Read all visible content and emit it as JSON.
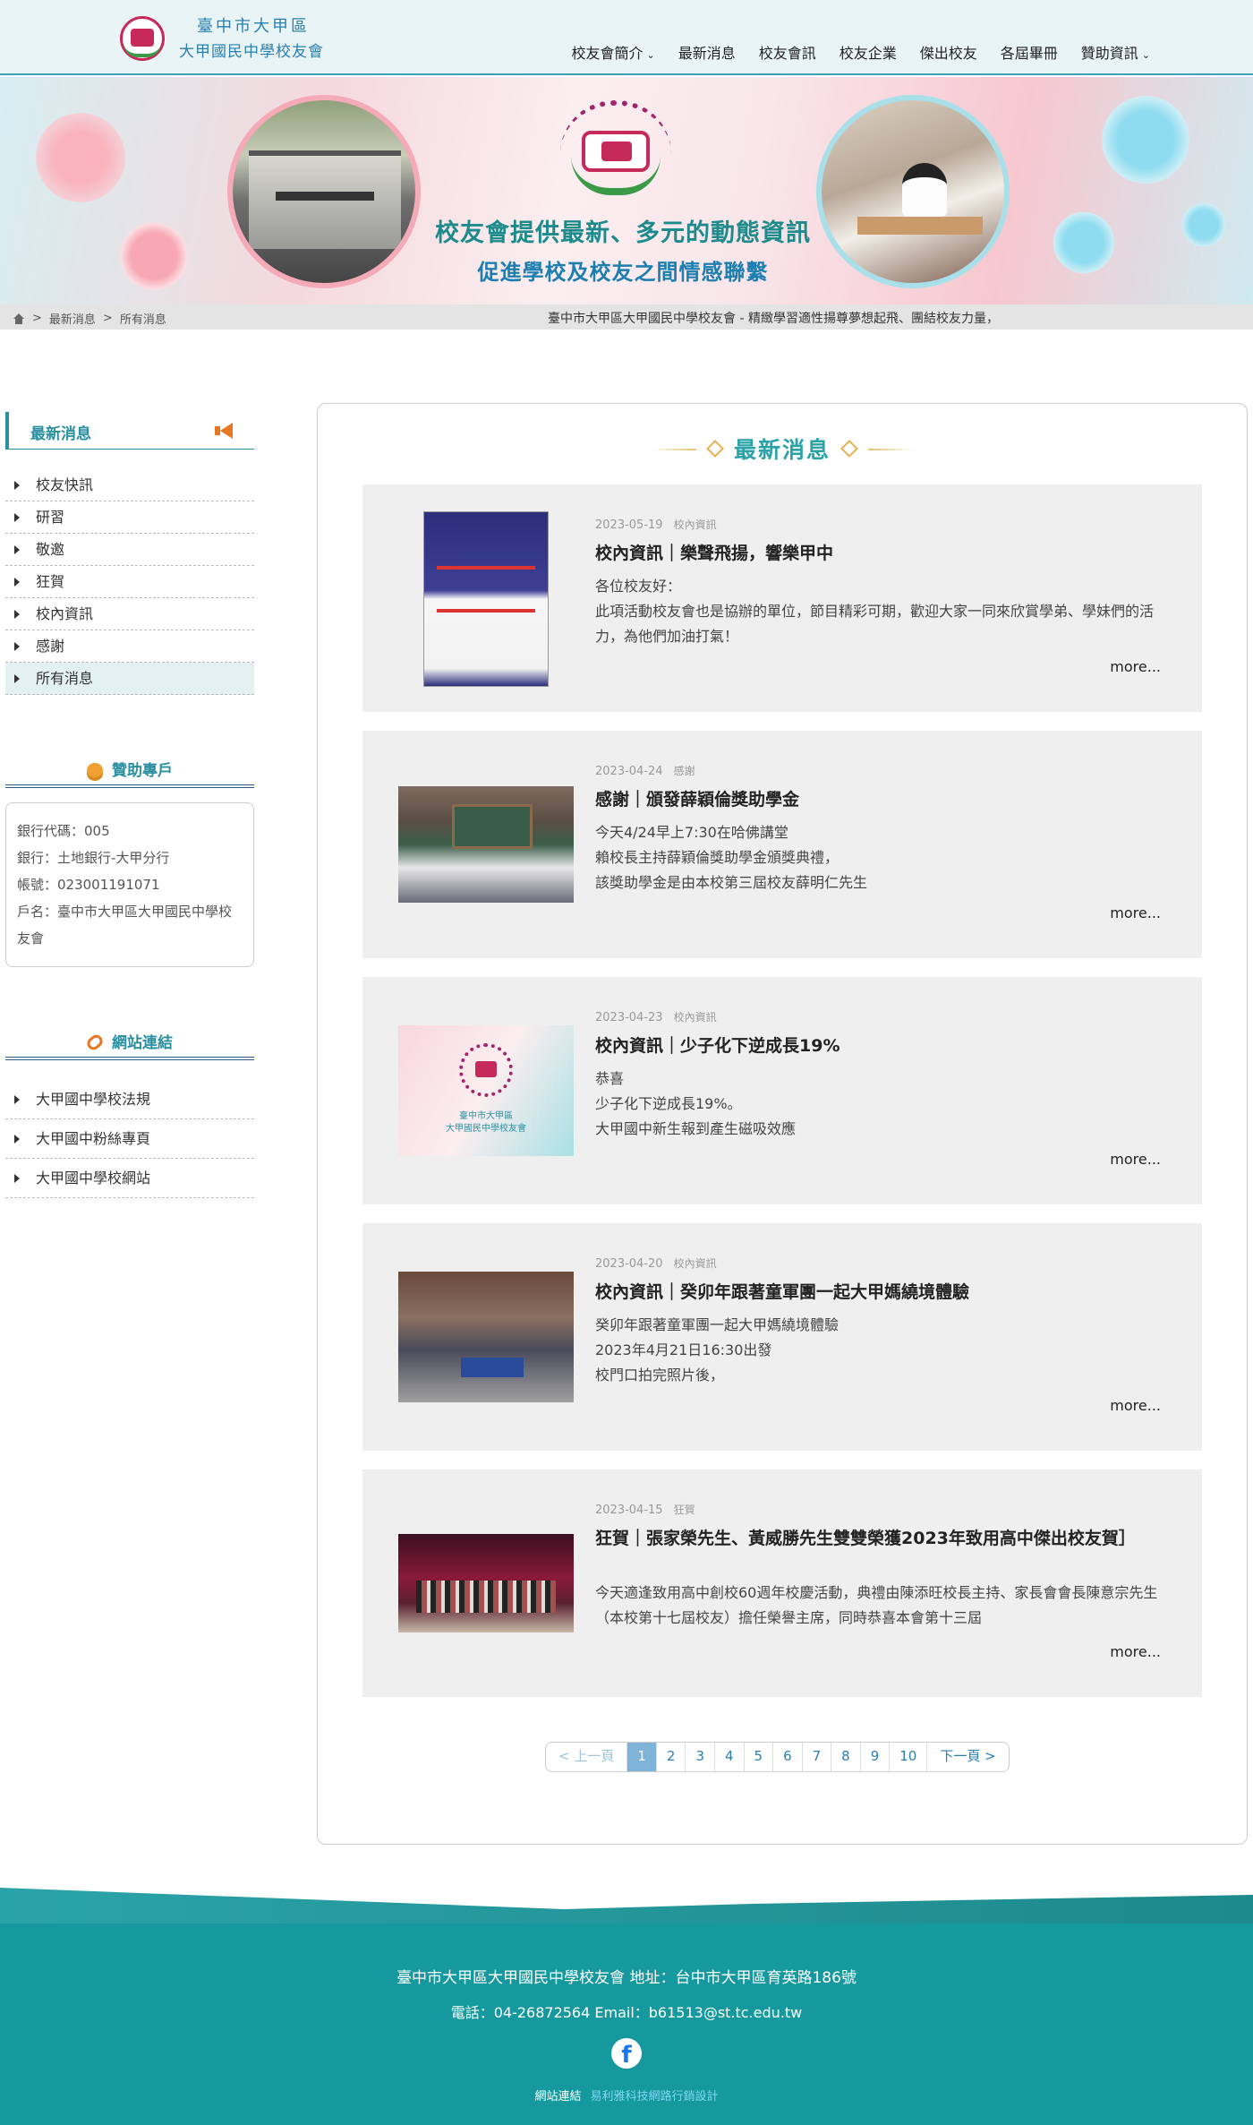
{
  "header": {
    "logo_line1": "臺中市大甲區",
    "logo_line2": "大甲國民中學校友會",
    "nav": [
      {
        "label": "校友會簡介",
        "dropdown": true
      },
      {
        "label": "最新消息",
        "dropdown": false
      },
      {
        "label": "校友會訊",
        "dropdown": false
      },
      {
        "label": "校友企業",
        "dropdown": false
      },
      {
        "label": "傑出校友",
        "dropdown": false
      },
      {
        "label": "各屆畢冊",
        "dropdown": false
      },
      {
        "label": "贊助資訊",
        "dropdown": true
      }
    ],
    "chevron": "⌄"
  },
  "banner": {
    "line1": "校友會提供最新、多元的動態資訊",
    "line2": "促進學校及校友之間情感聯繫"
  },
  "breadcrumb": {
    "sep": ">",
    "items": [
      "最新消息",
      "所有消息"
    ],
    "marquee": "臺中市大甲區大甲國民中學校友會 - 精緻學習適性揚尊夢想起飛、團結校友力量，"
  },
  "sidebar": {
    "news_title": "最新消息",
    "news_items": [
      "校友快訊",
      "研習",
      "敬邀",
      "狂賀",
      "校內資訊",
      "感謝",
      "所有消息"
    ],
    "active_index": 6,
    "sponsor_title": "贊助專戶",
    "bank_lines": [
      "銀行代碼：005",
      "銀行：土地銀行-大甲分行",
      "帳號：023001191071",
      "戶名：臺中市大甲區大甲國民中學校友會"
    ],
    "links_title": "網站連結",
    "links": [
      "大甲國中學校法規",
      "大甲國中粉絲專頁",
      "大甲國中學校網站"
    ]
  },
  "main": {
    "title": "最新消息",
    "more_label": "more...",
    "articles": [
      {
        "date": "2023-05-19",
        "category": "校內資訊",
        "title": "校內資訊｜樂聲飛揚，響樂甲中",
        "excerpt": [
          "各位校友好：",
          "此項活動校友會也是協辦的單位，節目精彩可期，歡迎大家一同來欣賞學弟、學妹們的活力，為他們加油打氣！"
        ],
        "thumb": "poster"
      },
      {
        "date": "2023-04-24",
        "category": "感謝",
        "title": "感謝｜頒發薛穎倫獎助學金",
        "excerpt": [
          "今天4/24早上7:30在哈佛講堂",
          "賴校長主持薛穎倫獎助學金頒獎典禮，",
          "該獎助學金是由本校第三屆校友薛明仁先生"
        ],
        "thumb": "classroom"
      },
      {
        "date": "2023-04-23",
        "category": "校內資訊",
        "title": "校內資訊｜少子化下逆成長19%",
        "excerpt": [
          "恭喜",
          "少子化下逆成長19%。",
          "大甲國中新生報到產生磁吸效應"
        ],
        "thumb": "logo",
        "thumb_caption1": "臺中市大甲區",
        "thumb_caption2": "大甲國民中學校友會"
      },
      {
        "date": "2023-04-20",
        "category": "校內資訊",
        "title": "校內資訊｜癸卯年跟著童軍團一起大甲媽繞境體驗",
        "excerpt": [
          "癸卯年跟著童軍團一起大甲媽繞境體驗",
          "2023年4月21日16:30出發",
          "校門口拍完照片後，"
        ],
        "thumb": "group"
      },
      {
        "date": "2023-04-15",
        "category": "狂賀",
        "title": "狂賀｜張家榮先生、黃威勝先生雙雙榮獲2023年致用高中傑出校友賀］",
        "excerpt": [
          "今天適逢致用高中創校60週年校慶活動，典禮由陳添旺校長主持、家長會會長陳意宗先生（本校第十七屆校友）擔任榮譽主席，同時恭喜本會第十三屆"
        ],
        "thumb": "stage"
      }
    ]
  },
  "pagination": {
    "prev": "< 上一頁",
    "pages": [
      "1",
      "2",
      "3",
      "4",
      "5",
      "6",
      "7",
      "8",
      "9",
      "10"
    ],
    "current": "1",
    "next": "下一頁 >"
  },
  "footer": {
    "line1": "臺中市大甲區大甲國民中學校友會  地址：台中市大甲區育英路186號",
    "line2": "電話：04-26872564  Email：b61513@st.tc.edu.tw",
    "fb_glyph": "f",
    "links_label": "網站連結",
    "credit": "易利雅科技網路行銷設計"
  }
}
